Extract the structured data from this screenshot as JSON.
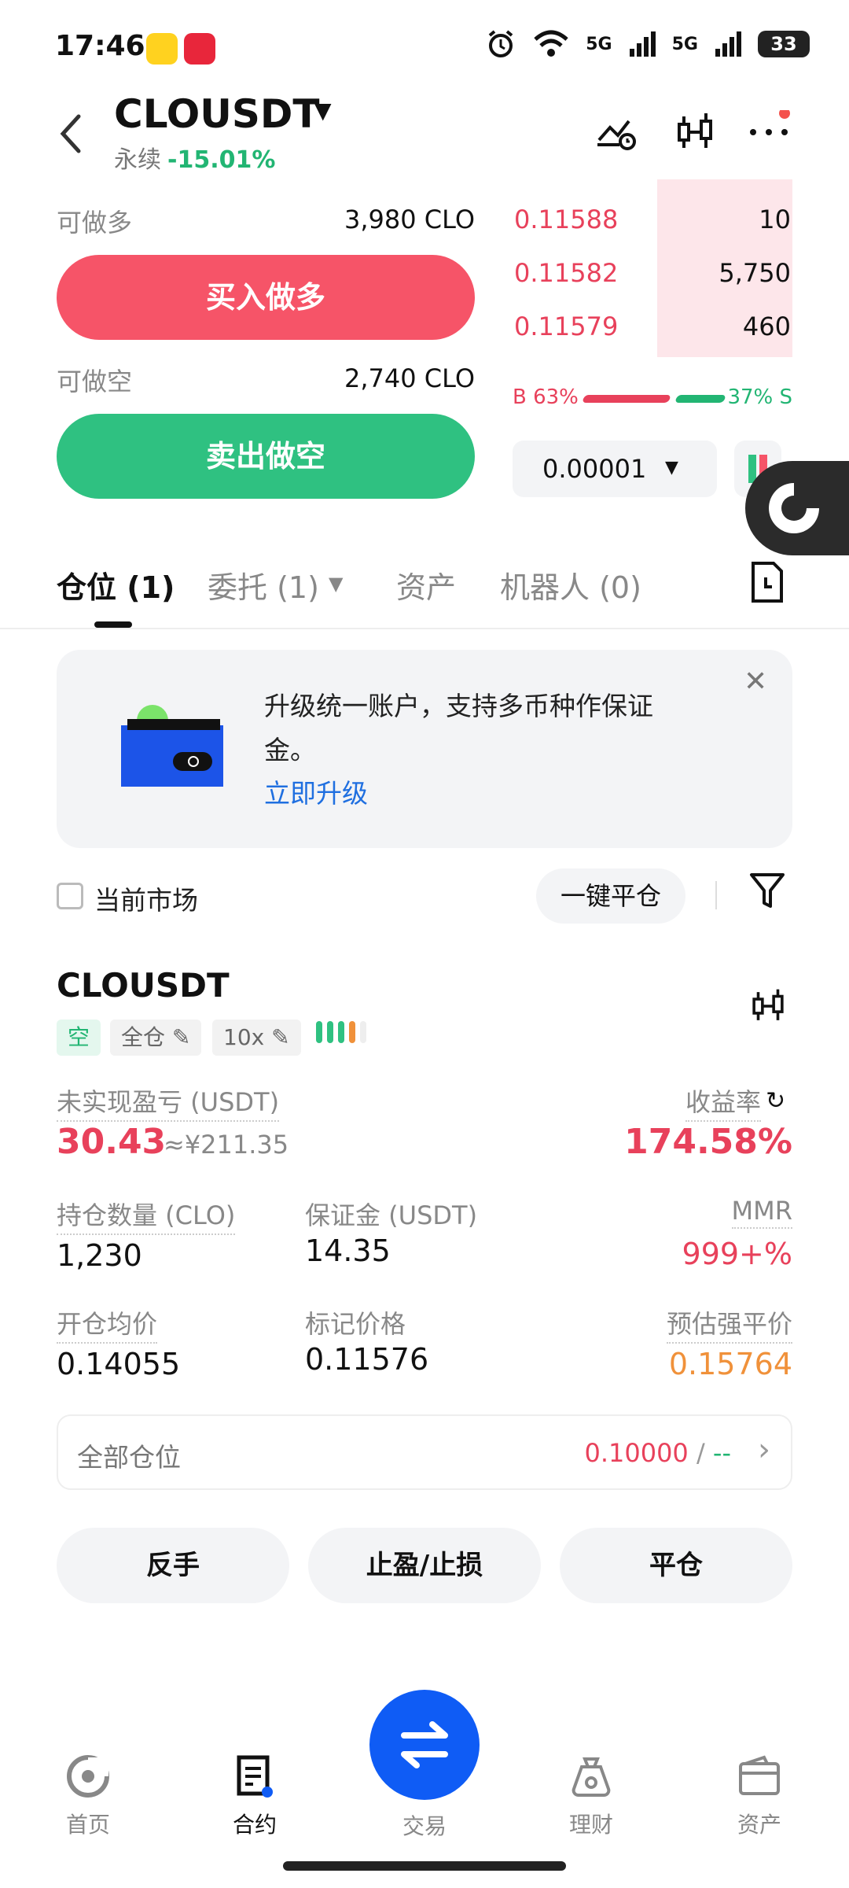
{
  "status_bar": {
    "time": "17:46",
    "battery": "33",
    "signal1": "5G",
    "signal2": "5G"
  },
  "header": {
    "symbol": "CLOUSDT",
    "contract_type": "永续",
    "change": "-15.01%"
  },
  "trade": {
    "long_label": "可做多",
    "long_amount": "3,980 CLO",
    "buy_button": "买入做多",
    "short_label": "可做空",
    "short_amount": "2,740 CLO",
    "sell_button": "卖出做空"
  },
  "order_book": {
    "asks": [
      {
        "price": "0.11588",
        "qty": "10",
        "depth": 0.3
      },
      {
        "price": "0.11582",
        "qty": "5,750",
        "depth": 0.35
      },
      {
        "price": "0.11579",
        "qty": "460",
        "depth": 0.35
      }
    ],
    "buy_ratio": "B 63%",
    "sell_ratio": "37% S",
    "precision": "0.00001"
  },
  "tabs": [
    {
      "label": "仓位 (1)"
    },
    {
      "label": "委托 (1)"
    },
    {
      "label": "资产"
    },
    {
      "label": "机器人 (0)"
    }
  ],
  "banner": {
    "text": "升级统一账户，支持多币种作保证金。",
    "link": "立即升级"
  },
  "filter": {
    "current_market": "当前市场",
    "close_all": "一键平仓"
  },
  "position": {
    "symbol": "CLOUSDT",
    "side_tag": "空",
    "margin_mode": "全仓",
    "leverage": "10x",
    "upnl_label": "未实现盈亏 (USDT)",
    "upnl_value": "30.43",
    "upnl_cny": "≈¥211.35",
    "roe_label": "收益率",
    "roe_value": "174.58%",
    "size_label": "持仓数量 (CLO)",
    "size_value": "1,230",
    "margin_label": "保证金 (USDT)",
    "margin_value": "14.35",
    "mmr_label": "MMR",
    "mmr_value": "999+%",
    "entry_label": "开仓均价",
    "entry_value": "0.14055",
    "mark_label": "标记价格",
    "mark_value": "0.11576",
    "liq_label": "预估强平价",
    "liq_value": "0.15764",
    "all_positions_label": "全部仓位",
    "all_positions_value": "0.10000",
    "all_positions_sep": " / ",
    "all_positions_value2": "--"
  },
  "actions": {
    "reverse": "反手",
    "tpsl": "止盈/止损",
    "close": "平仓"
  },
  "nav": {
    "home": "首页",
    "contract": "合约",
    "trade": "交易",
    "finance": "理财",
    "assets": "资产"
  },
  "colors": {
    "buy": "#f65468",
    "sell": "#2fc181",
    "accent": "#0f5cf5"
  }
}
